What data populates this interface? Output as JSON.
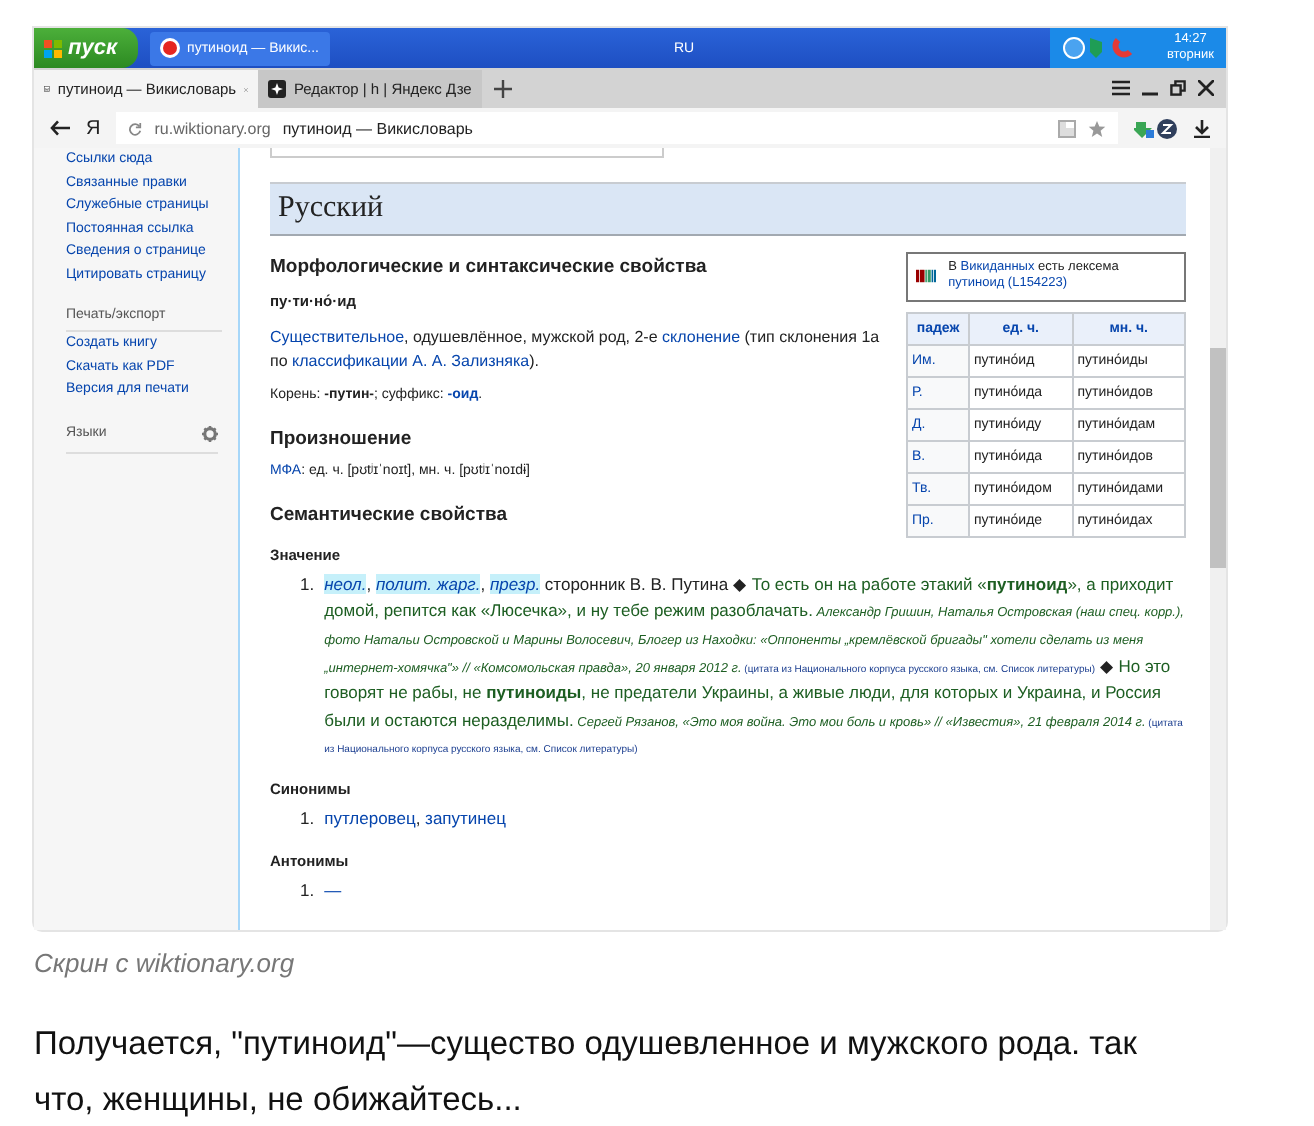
{
  "taskbar": {
    "start_label": "пуск",
    "tasks": [
      {
        "label": "путиноид — Викис...",
        "selected": true
      }
    ],
    "language": "RU",
    "time": "14:27",
    "day": "вторник"
  },
  "browser": {
    "tabs": [
      {
        "label": "путиноид — Викисловарь",
        "selected": true
      },
      {
        "label": "Редактор | h | Яндекс Дзе",
        "selected": false
      }
    ],
    "address": {
      "logo": "Я",
      "domain": "ru.wiktionary.org",
      "title": "путиноид — Викисловарь"
    }
  },
  "sidebar": {
    "top_links": [
      "Ссылки сюда",
      "Связанные правки",
      "Служебные страницы",
      "Постоянная ссылка",
      "Сведения о странице",
      "Цитировать страницу"
    ],
    "sections": [
      {
        "heading": "Печать/экспорт",
        "links": [
          "Создать книгу",
          "Скачать как PDF",
          "Версия для печати"
        ]
      }
    ],
    "languages_heading": "Языки"
  },
  "article": {
    "language_heading": "Русский",
    "wikidata": [
      {
        "kind": "text",
        "text": "В "
      },
      {
        "kind": "link",
        "text": "Викиданных"
      },
      {
        "kind": "text",
        "text": " есть лексема "
      },
      {
        "kind": "link",
        "text": "путиноид (L154223)"
      }
    ],
    "declension": {
      "columns": [
        "падеж",
        "ед. ч.",
        "мн. ч."
      ],
      "rows": [
        [
          "Им.",
          "путино́ид",
          "путино́иды"
        ],
        [
          "Р.",
          "путино́ида",
          "путино́идов"
        ],
        [
          "Д.",
          "путино́иду",
          "путино́идам"
        ],
        [
          "В.",
          "путино́ида",
          "путино́идов"
        ],
        [
          "Тв.",
          "путино́идом",
          "путино́идами"
        ],
        [
          "Пр.",
          "путино́иде",
          "путино́идах"
        ]
      ]
    },
    "morphology": {
      "heading": "Морфологические и синтаксические свойства",
      "hyphenation": "пу·ти·но́·ид",
      "description": [
        {
          "kind": "link",
          "text": "Существительное"
        },
        {
          "kind": "text",
          "text": ", одушевлённое, мужской род, 2-е "
        },
        {
          "kind": "link",
          "text": "склонение"
        },
        {
          "kind": "text",
          "text": " (тип склонения 1a по "
        },
        {
          "kind": "link",
          "text": "классификации А. А. Зализняка"
        },
        {
          "kind": "text",
          "text": ")."
        }
      ],
      "root": [
        {
          "kind": "text",
          "text": "Корень: "
        },
        {
          "kind": "bold",
          "text": "-путин-"
        },
        {
          "kind": "text",
          "text": "; суффикс: "
        },
        {
          "kind": "boldlink",
          "text": "-оид"
        },
        {
          "kind": "text",
          "text": "."
        }
      ]
    },
    "pronunciation": {
      "heading": "Произношение",
      "ipa": [
        {
          "kind": "link",
          "text": "МФА"
        },
        {
          "kind": "text",
          "text": ": ед. ч. [pʊtʲɪˈnoɪt], мн. ч. [pʊtʲɪˈnoɪdɨ]"
        }
      ]
    },
    "semantics": {
      "heading": "Семантические свойства",
      "meaning_heading": "Значение",
      "definitions": [
        {
          "number": "1.",
          "segments": [
            {
              "kind": "label",
              "text": "неол."
            },
            {
              "kind": "text",
              "text": ", "
            },
            {
              "kind": "label",
              "text": "полит. жарг."
            },
            {
              "kind": "text",
              "text": ", "
            },
            {
              "kind": "label",
              "text": "презр."
            },
            {
              "kind": "text",
              "text": " сторонник В. В. Путина ◆ "
            },
            {
              "kind": "quote",
              "text": "То есть он на работе этакий «**путиноид**», а приходит домой, репится как «Люсечка», и ну тебе режим разоблачать."
            },
            {
              "kind": "source",
              "text": " Александр Гришин, Наталья Островская (наш спец. корр.), фото Натальи Островской и Марины Волосевич, Блогер из Находки: «Оппоненты „кремлёвской бригады\" хотели сделать из меня „интернет-хомячка\"» // «Комсомольская правда», 20 января 2012 г."
            },
            {
              "kind": "note",
              "text": " (цитата из Национального корпуса русского языка, см. Список литературы)"
            },
            {
              "kind": "text",
              "text": " ◆ "
            },
            {
              "kind": "quote",
              "text": "Но это говорят не рабы, не **путиноиды**, не предатели Украины, а живые люди, для которых и Украина, и Россия были и остаются неразделимы."
            },
            {
              "kind": "source",
              "text": " Сергей Рязанов, «Это моя война. Это мои боль и кровь» // «Известия», 21 февраля 2014 г."
            },
            {
              "kind": "note",
              "text": " (цитата из Национального корпуса русского языка, см. Список литературы)"
            }
          ]
        }
      ],
      "synonyms_heading": "Синонимы",
      "synonyms": [
        {
          "number": "1.",
          "segments": [
            {
              "kind": "link",
              "text": "путлеровец"
            },
            {
              "kind": "text",
              "text": ", "
            },
            {
              "kind": "link",
              "text": "запутинец"
            }
          ]
        }
      ],
      "antonyms_heading": "Антонимы",
      "antonyms": [
        {
          "number": "1.",
          "segments": [
            {
              "kind": "link",
              "text": "—"
            }
          ]
        }
      ]
    }
  },
  "caption": "Скрин с wiktionary.org",
  "paragraph": "Получается, \"путиноид\"—существо одушевленное и мужского рода. так что, женщины, не обижайтесь..."
}
